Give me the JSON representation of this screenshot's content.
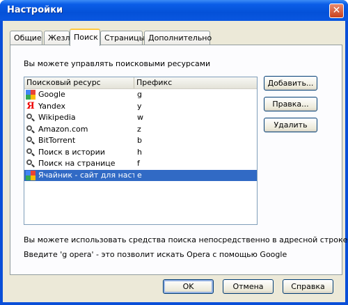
{
  "window": {
    "title": "Настройки",
    "close_glyph": "✕"
  },
  "tabs": [
    {
      "label": "Общие",
      "active": false
    },
    {
      "label": "Жезл",
      "active": false
    },
    {
      "label": "Поиск",
      "active": true
    },
    {
      "label": "Страницы",
      "active": false
    },
    {
      "label": "Дополнительно",
      "active": false
    }
  ],
  "search": {
    "intro": "Вы можете управлять поисковыми ресурсами",
    "columns": [
      "Поисковый ресурс",
      "Префикс"
    ],
    "rows": [
      {
        "name": "Google",
        "prefix": "g",
        "icon": "google-icon",
        "selected": false
      },
      {
        "name": "Yandex",
        "prefix": "y",
        "icon": "yandex-icon",
        "selected": false
      },
      {
        "name": "Wikipedia",
        "prefix": "w",
        "icon": "magnifier-icon",
        "selected": false
      },
      {
        "name": "Amazon.com",
        "prefix": "z",
        "icon": "magnifier-icon",
        "selected": false
      },
      {
        "name": "BitTorrent",
        "prefix": "b",
        "icon": "magnifier-icon",
        "selected": false
      },
      {
        "name": "Поиск в истории",
        "prefix": "h",
        "icon": "magnifier-icon",
        "selected": false
      },
      {
        "name": "Поиск на странице",
        "prefix": "f",
        "icon": "magnifier-icon",
        "selected": false
      },
      {
        "name": "Ячайник - сайт для насто...",
        "prefix": "e",
        "icon": "google-icon",
        "selected": true
      }
    ],
    "buttons": {
      "add": "Добавить...",
      "edit": "Правка...",
      "delete": "Удалить"
    },
    "footer_line1": "Вы можете использовать средства поиска непосредственно в адресной строке.",
    "footer_line2": "Введите 'g opera' - это позволит искать Opera с помощью Google"
  },
  "dialog_buttons": {
    "ok": "OK",
    "cancel": "Отмена",
    "help": "Справка"
  },
  "colors": {
    "titlebar": "#0451d8",
    "selection": "#316ac5",
    "active_tab_accent": "#ffc83c"
  }
}
